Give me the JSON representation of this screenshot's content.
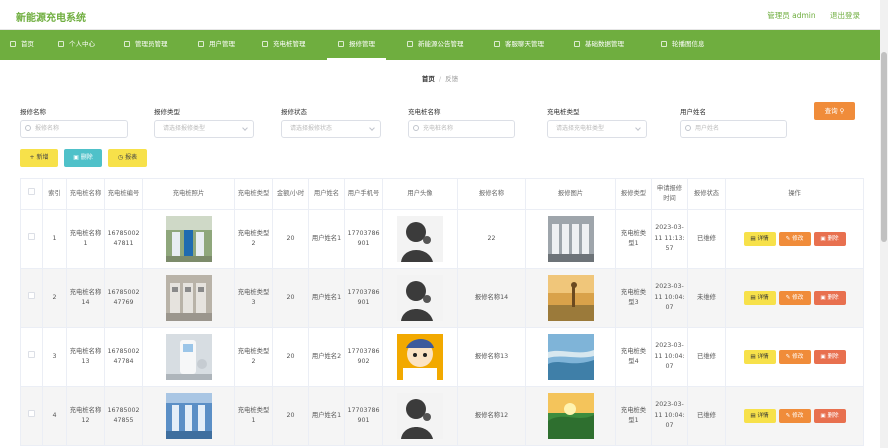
{
  "header": {
    "title": "新能源充电系统",
    "user": "管理员 admin",
    "logout": "退出登录"
  },
  "nav": {
    "items": [
      {
        "label": "首页"
      },
      {
        "label": "个人中心"
      },
      {
        "label": "管理员管理"
      },
      {
        "label": "用户管理"
      },
      {
        "label": "充电桩管理"
      },
      {
        "label": "报修管理"
      },
      {
        "label": "新能源公告管理"
      },
      {
        "label": "客服聊天管理"
      },
      {
        "label": "基础数据管理"
      },
      {
        "label": "轮播图信息"
      }
    ],
    "active_index": 5
  },
  "breadcrumb": {
    "home": "首页",
    "separator": "/",
    "current": "反馈"
  },
  "search": {
    "fields": [
      {
        "label": "报修名称",
        "placeholder": "报修名称",
        "type": "input"
      },
      {
        "label": "报修类型",
        "placeholder": "请选择报修类型",
        "type": "select"
      },
      {
        "label": "报修状态",
        "placeholder": "请选择报修状态",
        "type": "select"
      },
      {
        "label": "充电桩名称",
        "placeholder": "充电桩名称",
        "type": "input"
      },
      {
        "label": "充电桩类型",
        "placeholder": "请选择充电桩类型",
        "type": "select"
      },
      {
        "label": "用户姓名",
        "placeholder": "用户姓名",
        "type": "input"
      }
    ],
    "query_label": "查询"
  },
  "actions": {
    "add": "新增",
    "delete": "删除",
    "report": "报表"
  },
  "table": {
    "columns": [
      "索引",
      "充电桩名称",
      "充电桩编号",
      "充电桩照片",
      "充电桩类型",
      "金额/小时",
      "用户姓名",
      "用户手机号",
      "用户头像",
      "报修名称",
      "报修图片",
      "报修类型",
      "申请报修时间",
      "报修状态",
      "操作"
    ],
    "row_buttons": {
      "detail": "详情",
      "edit": "修改",
      "delete": "删除"
    },
    "rows": [
      {
        "index": "1",
        "pile_name": "充电桩名称1",
        "pile_no": "1678500247811",
        "pile_type": "充电桩类型2",
        "price": "20",
        "user_name": "用户姓名1",
        "phone": "17703786901",
        "repair_name": "22",
        "repair_type": "充电桩类型1",
        "apply_time": "2023-03-11 11:13:57",
        "status": "已维修",
        "pile_photo": "wall-chargers",
        "avatar": "silhouette",
        "repair_image": "charger-row"
      },
      {
        "index": "2",
        "pile_name": "充电桩名称14",
        "pile_no": "1678500247769",
        "pile_type": "充电桩类型3",
        "price": "20",
        "user_name": "用户姓名1",
        "phone": "17703786901",
        "repair_name": "报修名称14",
        "repair_type": "充电桩类型3",
        "apply_time": "2023-03-11 10:04:07",
        "status": "未维修",
        "pile_photo": "charging-stations",
        "avatar": "silhouette",
        "repair_image": "giraffe-field"
      },
      {
        "index": "3",
        "pile_name": "充电桩名称13",
        "pile_no": "1678500247784",
        "pile_type": "充电桩类型2",
        "price": "20",
        "user_name": "用户姓名2",
        "phone": "17703786902",
        "repair_name": "报修名称13",
        "repair_type": "充电桩类型4",
        "apply_time": "2023-03-11 10:04:07",
        "status": "已维修",
        "pile_photo": "white-charger",
        "avatar": "cartoon-boy",
        "repair_image": "coast-aerial"
      },
      {
        "index": "4",
        "pile_name": "充电桩名称12",
        "pile_no": "1678500247855",
        "pile_type": "充电桩类型1",
        "price": "20",
        "user_name": "用户姓名1",
        "phone": "17703786901",
        "repair_name": "报修名称12",
        "repair_type": "充电桩类型1",
        "apply_time": "2023-03-11 10:04:07",
        "status": "已维修",
        "pile_photo": "blue-chargers",
        "avatar": "silhouette",
        "repair_image": "sunset-valley"
      }
    ]
  },
  "colors": {
    "brand_green": "#6fae3f",
    "query_orange": "#f08c3a",
    "yellow_btn": "#f7e14a",
    "teal_btn": "#4fc1c9",
    "delete_red": "#e8704f"
  }
}
